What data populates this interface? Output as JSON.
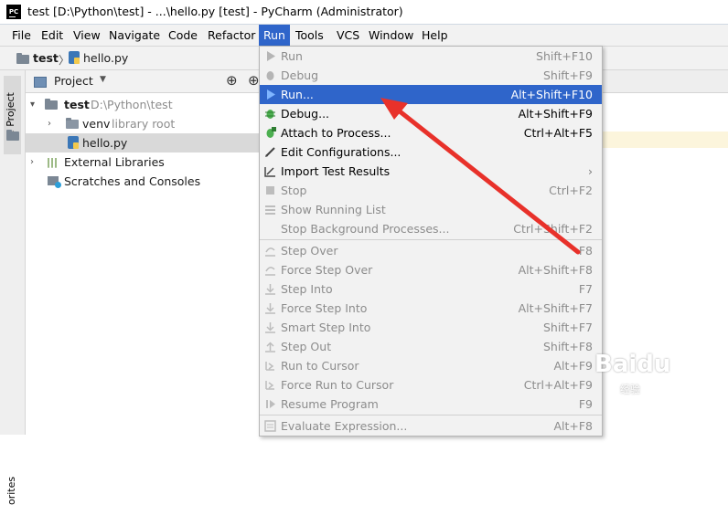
{
  "window": {
    "title": "test [D:\\Python\\test] - ...\\hello.py [test] - PyCharm (Administrator)",
    "app_icon_text": "PC"
  },
  "menubar": {
    "items": [
      {
        "label": "File"
      },
      {
        "label": "Edit"
      },
      {
        "label": "View"
      },
      {
        "label": "Navigate"
      },
      {
        "label": "Code"
      },
      {
        "label": "Refactor"
      },
      {
        "label": "Run"
      },
      {
        "label": "Tools"
      },
      {
        "label": "VCS"
      },
      {
        "label": "Window"
      },
      {
        "label": "Help"
      }
    ],
    "active": "Run"
  },
  "navbar": {
    "crumbs": [
      {
        "label": "test"
      },
      {
        "label": "hello.py"
      }
    ]
  },
  "left_strip": {
    "tab_label": "1: Project",
    "bottom_label": "orites"
  },
  "project_panel": {
    "header_label": "Project",
    "tree": [
      {
        "label": "test",
        "sub": "D:\\Python\\test"
      },
      {
        "label": "venv",
        "sub": "library root"
      },
      {
        "label": "hello.py",
        "sub": ""
      },
      {
        "label": "External Libraries",
        "sub": ""
      },
      {
        "label": "Scratches and Consoles",
        "sub": ""
      }
    ]
  },
  "run_menu": {
    "items": [
      {
        "label": "Run",
        "shortcut": "Shift+F10",
        "icon": "run-icon",
        "state": "disabled"
      },
      {
        "label": "Debug",
        "shortcut": "Shift+F9",
        "icon": "debug-icon",
        "state": "disabled"
      },
      {
        "label": "Run...",
        "shortcut": "Alt+Shift+F10",
        "icon": "run-icon",
        "state": "selected"
      },
      {
        "label": "Debug...",
        "shortcut": "Alt+Shift+F9",
        "icon": "debug-icon",
        "state": "enabled"
      },
      {
        "label": "Attach to Process...",
        "shortcut": "Ctrl+Alt+F5",
        "icon": "attach-icon",
        "state": "enabled"
      },
      {
        "label": "Edit Configurations...",
        "shortcut": "",
        "icon": "edit-icon",
        "state": "enabled"
      },
      {
        "label": "Import Test Results",
        "shortcut": "",
        "icon": "import-icon",
        "state": "enabled",
        "submenu": true
      },
      {
        "label": "Stop",
        "shortcut": "Ctrl+F2",
        "icon": "stop-icon",
        "state": "disabled"
      },
      {
        "label": "Show Running List",
        "shortcut": "",
        "icon": "list-icon",
        "state": "disabled"
      },
      {
        "label": "Stop Background Processes...",
        "shortcut": "Ctrl+Shift+F2",
        "icon": "",
        "state": "disabled"
      },
      {
        "label": "Step Over",
        "shortcut": "F8",
        "icon": "step-over-icon",
        "state": "disabled"
      },
      {
        "label": "Force Step Over",
        "shortcut": "Alt+Shift+F8",
        "icon": "force-step-over-icon",
        "state": "disabled"
      },
      {
        "label": "Step Into",
        "shortcut": "F7",
        "icon": "step-into-icon",
        "state": "disabled"
      },
      {
        "label": "Force Step Into",
        "shortcut": "Alt+Shift+F7",
        "icon": "force-step-into-icon",
        "state": "disabled"
      },
      {
        "label": "Smart Step Into",
        "shortcut": "Shift+F7",
        "icon": "smart-step-into-icon",
        "state": "disabled"
      },
      {
        "label": "Step Out",
        "shortcut": "Shift+F8",
        "icon": "step-out-icon",
        "state": "disabled"
      },
      {
        "label": "Run to Cursor",
        "shortcut": "Alt+F9",
        "icon": "run-to-cursor-icon",
        "state": "disabled"
      },
      {
        "label": "Force Run to Cursor",
        "shortcut": "Ctrl+Alt+F9",
        "icon": "force-run-to-cursor-icon",
        "state": "disabled"
      },
      {
        "label": "Resume Program",
        "shortcut": "F9",
        "icon": "resume-icon",
        "state": "disabled"
      },
      {
        "label": "Evaluate Expression...",
        "shortcut": "Alt+F8",
        "icon": "evaluate-icon",
        "state": "disabled"
      }
    ]
  },
  "watermark": {
    "text": "Baidu",
    "sub": "经验"
  },
  "colors": {
    "menu_highlight": "#2f65ca",
    "arrow": "#e8312a",
    "menu_bg": "#f2f2f2"
  }
}
